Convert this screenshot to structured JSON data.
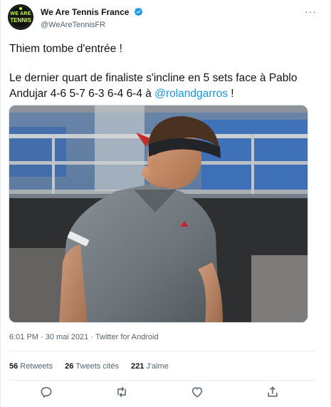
{
  "author": {
    "display_name": "We Are Tennis France",
    "handle": "@WeAreTennisFR",
    "avatar_line1": "WE ARE",
    "avatar_line2": "TENNIS",
    "verified": true,
    "avatar_text_color": "#c8ff3c"
  },
  "more_label": "···",
  "tweet": {
    "line1": "Thiem tombe d'entrée !",
    "line2": "Le dernier quart de finaliste s'incline en 5 sets face à Pablo Andujar 4-6 5-7 6-3 6-4 6-4 à ",
    "mention": "@rolandgarros",
    "line2_end": " !"
  },
  "meta": {
    "time": "6:01 PM",
    "separator1": " · ",
    "date": "30 mai 2021",
    "separator2": " · ",
    "source": "Twitter for Android"
  },
  "stats": {
    "retweets_count": "56",
    "retweets_label": "Retweets",
    "quotes_count": "26",
    "quotes_label": "Tweets cités",
    "likes_count": "221",
    "likes_label": "J'aime"
  },
  "colors": {
    "link": "#1b95e0",
    "secondary_text": "#536471",
    "primary_text": "#0f1419",
    "divider": "#e6ecf0"
  },
  "actions": [
    {
      "icon": "reply-icon"
    },
    {
      "icon": "retweet-icon"
    },
    {
      "icon": "like-icon"
    },
    {
      "icon": "share-icon"
    }
  ]
}
